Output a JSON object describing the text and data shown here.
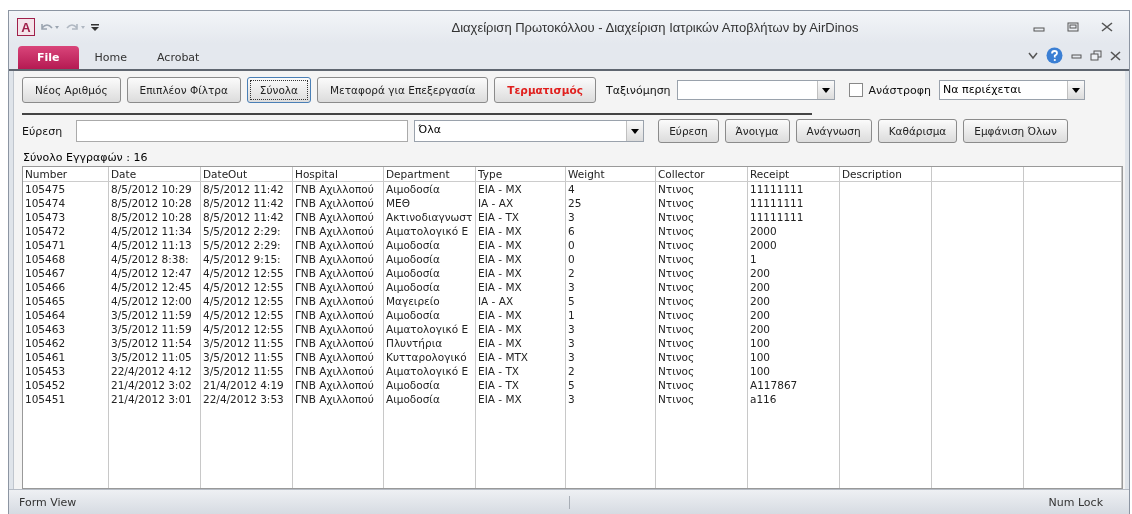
{
  "window": {
    "title": "Διαχείριση Πρωτοκόλλου  -  Διαχείριση Ιατρικών Αποβλήτων by AirDinos",
    "app_icon_letter": "A"
  },
  "ribbon_tabs": [
    {
      "label": "File",
      "selected": true
    },
    {
      "label": "Home",
      "selected": false
    },
    {
      "label": "Acrobat",
      "selected": false
    }
  ],
  "buttons": [
    {
      "label": "Νέος Αριθμός",
      "kind": "normal"
    },
    {
      "label": "Επιπλέον Φίλτρα",
      "kind": "normal"
    },
    {
      "label": "Σύνολα",
      "kind": "focused"
    },
    {
      "label": "Μεταφορά για Επεξεργασία",
      "kind": "normal"
    },
    {
      "label": "Τερματισμός",
      "kind": "danger"
    }
  ],
  "sort": {
    "label": "Ταξινόμηση",
    "reverse_label": "Ανάστροφη",
    "reverse_checked": false,
    "match_value": "Να περιέχεται"
  },
  "search": {
    "label": "Εύρεση",
    "scope_value": "Όλα",
    "buttons": [
      "Εύρεση",
      "Άνοιγμα",
      "Ανάγνωση",
      "Καθάρισμα",
      "Εμφάνιση Όλων"
    ]
  },
  "record_count": "Σύνολο Εγγραφών : 16",
  "table": {
    "columns": [
      "Number",
      "Date",
      "DateOut",
      "Hospital",
      "Department",
      "Type",
      "Weight",
      "Collector",
      "Receipt",
      "Description"
    ],
    "rows": [
      [
        "105475",
        "8/5/2012 10:29",
        "8/5/2012 11:42",
        "ΓΝΒ Αχιλλοπού",
        "Αιμοδοσία",
        "ΕΙΑ - ΜΧ",
        "4",
        "Ντινος",
        "11111111",
        ""
      ],
      [
        "105474",
        "8/5/2012 10:28",
        "8/5/2012 11:42",
        "ΓΝΒ Αχιλλοπού",
        "ΜΕΘ",
        "ΙΑ - ΑΧ",
        "25",
        "Ντινος",
        "11111111",
        ""
      ],
      [
        "105473",
        "8/5/2012 10:28",
        "8/5/2012 11:42",
        "ΓΝΒ Αχιλλοπού",
        "Ακτινοδιαγνωστ",
        "ΕΙΑ - ΤΧ",
        "3",
        "Ντινος",
        "11111111",
        ""
      ],
      [
        "105472",
        "4/5/2012 11:34",
        "5/5/2012 2:29:",
        "ΓΝΒ Αχιλλοπού",
        "Αιματολογικό Ε",
        "ΕΙΑ - ΜΧ",
        "6",
        "Ντινος",
        "2000",
        ""
      ],
      [
        "105471",
        "4/5/2012 11:13",
        "5/5/2012 2:29:",
        "ΓΝΒ Αχιλλοπού",
        "Αιμοδοσία",
        "ΕΙΑ - ΜΧ",
        "0",
        "Ντινος",
        "2000",
        ""
      ],
      [
        "105468",
        "4/5/2012 8:38:",
        "4/5/2012 9:15:",
        "ΓΝΒ Αχιλλοπού",
        "Αιμοδοσία",
        "ΕΙΑ - ΜΧ",
        "0",
        "Ντινος",
        "1",
        ""
      ],
      [
        "105467",
        "4/5/2012 12:47",
        "4/5/2012 12:55",
        "ΓΝΒ Αχιλλοπού",
        "Αιμοδοσία",
        "ΕΙΑ - ΜΧ",
        "2",
        "Ντινος",
        "200",
        ""
      ],
      [
        "105466",
        "4/5/2012 12:45",
        "4/5/2012 12:55",
        "ΓΝΒ Αχιλλοπού",
        "Αιμοδοσία",
        "ΕΙΑ - ΜΧ",
        "3",
        "Ντινος",
        "200",
        ""
      ],
      [
        "105465",
        "4/5/2012 12:00",
        "4/5/2012 12:55",
        "ΓΝΒ Αχιλλοπού",
        "Μαγειρείο",
        "ΙΑ - ΑΧ",
        "5",
        "Ντινος",
        "200",
        ""
      ],
      [
        "105464",
        "3/5/2012 11:59",
        "4/5/2012 12:55",
        "ΓΝΒ Αχιλλοπού",
        "Αιμοδοσία",
        "ΕΙΑ - ΜΧ",
        "1",
        "Ντινος",
        "200",
        ""
      ],
      [
        "105463",
        "3/5/2012 11:59",
        "4/5/2012 12:55",
        "ΓΝΒ Αχιλλοπού",
        "Αιματολογικό Ε",
        "ΕΙΑ - ΜΧ",
        "3",
        "Ντινος",
        "200",
        ""
      ],
      [
        "105462",
        "3/5/2012 11:54",
        "3/5/2012 11:55",
        "ΓΝΒ Αχιλλοπού",
        "Πλυντήρια",
        "ΕΙΑ - ΜΧ",
        "3",
        "Ντινος",
        "100",
        ""
      ],
      [
        "105461",
        "3/5/2012 11:05",
        "3/5/2012 11:55",
        "ΓΝΒ Αχιλλοπού",
        "Κυτταρολογικό",
        "ΕΙΑ - ΜΤΧ",
        "3",
        "Ντινος",
        "100",
        ""
      ],
      [
        "105453",
        "22/4/2012 4:12",
        "3/5/2012 11:55",
        "ΓΝΒ Αχιλλοπού",
        "Αιματολογικό Ε",
        "ΕΙΑ - ΤΧ",
        "2",
        "Ντινος",
        "100",
        ""
      ],
      [
        "105452",
        "21/4/2012 3:02",
        "21/4/2012 4:19",
        "ΓΝΒ Αχιλλοπού",
        "Αιμοδοσία",
        "ΕΙΑ - ΤΧ",
        "5",
        "Ντινος",
        "Α117867",
        ""
      ],
      [
        "105451",
        "21/4/2012 3:01",
        "22/4/2012 3:53",
        "ΓΝΒ Αχιλλοπού",
        "Αιμοδοσία",
        "ΕΙΑ - ΜΧ",
        "3",
        "Ντινος",
        "a116",
        ""
      ]
    ]
  },
  "status_bar": {
    "left": "Form View",
    "right": "Num Lock"
  }
}
